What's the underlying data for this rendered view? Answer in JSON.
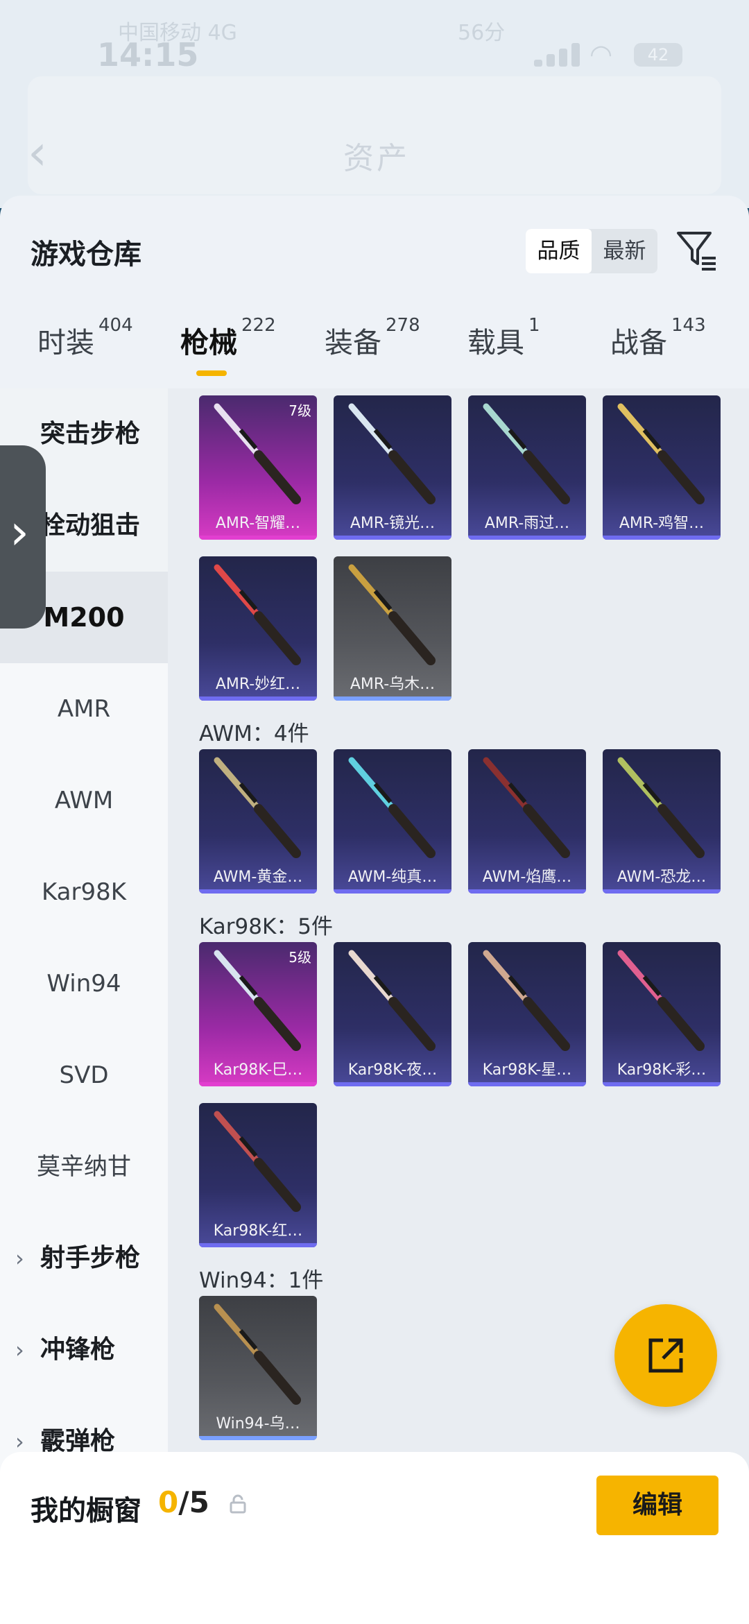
{
  "status_bar": {
    "time": "14:15",
    "carrier": "中国移动 4G",
    "carrier_right": "56分",
    "battery": "42"
  },
  "nav": {
    "back_icon": "chevron-left-icon",
    "title": "资产"
  },
  "warehouse": {
    "title": "游戏仓库",
    "sort_options": [
      "品质",
      "最新"
    ],
    "active_sort": "品质",
    "filter_icon": "filter-icon"
  },
  "tabs": [
    {
      "label": "时装",
      "count": "404"
    },
    {
      "label": "枪械",
      "count": "222",
      "active": true
    },
    {
      "label": "装备",
      "count": "278"
    },
    {
      "label": "载具",
      "count": "1"
    },
    {
      "label": "战备",
      "count": "143"
    }
  ],
  "sidebar": {
    "items": [
      {
        "label": "突击步枪",
        "type": "group"
      },
      {
        "label": "栓动狙击",
        "type": "group"
      },
      {
        "label": "M200",
        "type": "selected"
      },
      {
        "label": "AMR",
        "type": "sub"
      },
      {
        "label": "AWM",
        "type": "sub"
      },
      {
        "label": "Kar98K",
        "type": "sub"
      },
      {
        "label": "Win94",
        "type": "sub"
      },
      {
        "label": "SVD",
        "type": "sub"
      },
      {
        "label": "莫辛纳甘",
        "type": "sub"
      },
      {
        "label": "射手步枪",
        "type": "group"
      },
      {
        "label": "冲锋枪",
        "type": "group"
      },
      {
        "label": "霰弹枪",
        "type": "group"
      }
    ]
  },
  "sections": [
    {
      "label": "",
      "items": [
        {
          "name": "AMR-智耀…",
          "level": "7级",
          "rarity": "pink"
        },
        {
          "name": "AMR-镜光…",
          "rarity": "purple"
        },
        {
          "name": "AMR-雨过…",
          "rarity": "purple"
        },
        {
          "name": "AMR-鸡智…",
          "rarity": "purple"
        },
        {
          "name": "AMR-妙红…",
          "rarity": "purple"
        },
        {
          "name": "AMR-乌木…",
          "rarity": "grey"
        }
      ]
    },
    {
      "label": "AWM：4件",
      "items": [
        {
          "name": "AWM-黄金…",
          "rarity": "purple"
        },
        {
          "name": "AWM-纯真…",
          "rarity": "purple"
        },
        {
          "name": "AWM-焰鹰…",
          "rarity": "purple"
        },
        {
          "name": "AWM-恐龙…",
          "rarity": "purple"
        }
      ]
    },
    {
      "label": "Kar98K：5件",
      "items": [
        {
          "name": "Kar98K-巳…",
          "level": "5级",
          "rarity": "pink"
        },
        {
          "name": "Kar98K-夜…",
          "rarity": "purple"
        },
        {
          "name": "Kar98K-星…",
          "rarity": "purple"
        },
        {
          "name": "Kar98K-彩…",
          "rarity": "purple"
        },
        {
          "name": "Kar98K-红…",
          "rarity": "purple"
        }
      ]
    },
    {
      "label": "Win94：1件",
      "items": [
        {
          "name": "Win94-乌…",
          "rarity": "grey"
        }
      ]
    }
  ],
  "share_icon": "share-icon",
  "showcase": {
    "title": "我的橱窗",
    "current": "0",
    "total": "/5",
    "lock_icon": "lock-icon",
    "edit_label": "编辑"
  },
  "colors": {
    "accent": "#f6b400",
    "purple_card": "#2e2f66",
    "pink_card": "#d83bc4",
    "grey_card": "#55575c"
  }
}
